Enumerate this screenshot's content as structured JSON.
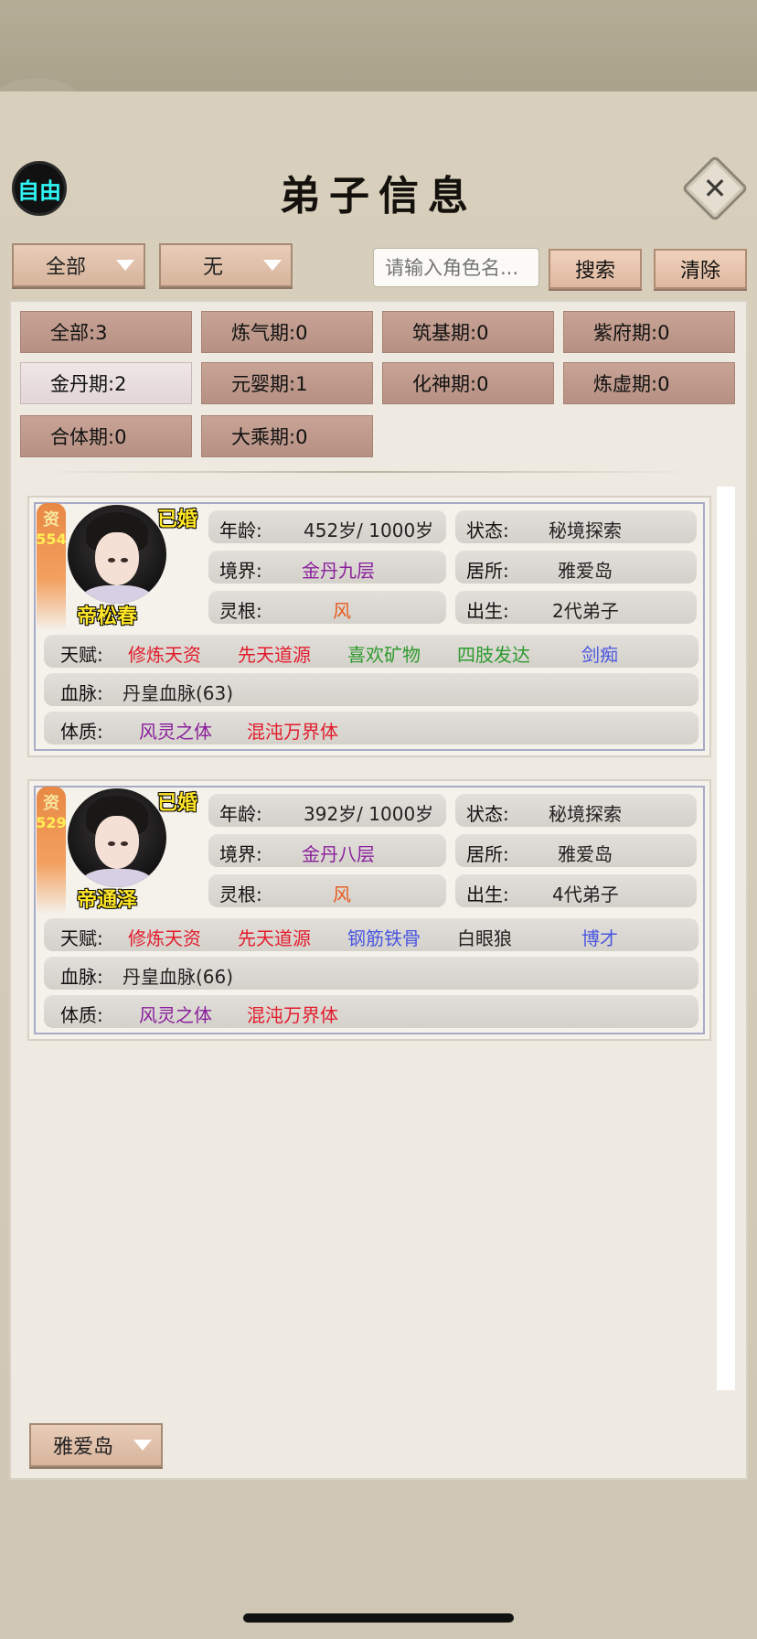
{
  "header": {
    "logo_label": "自由",
    "title": "弟子信息",
    "close_glyph": "✕"
  },
  "filters": {
    "category": "全部",
    "sub_filter": "无",
    "search_placeholder": "请输入角色名...",
    "search_label": "搜索",
    "clear_label": "清除"
  },
  "stages": [
    {
      "label": "全部:3",
      "active": false
    },
    {
      "label": "炼气期:0",
      "active": false
    },
    {
      "label": "筑基期:0",
      "active": false
    },
    {
      "label": "紫府期:0",
      "active": false
    },
    {
      "label": "金丹期:2",
      "active": true
    },
    {
      "label": "元婴期:1",
      "active": false
    },
    {
      "label": "化神期:0",
      "active": false
    },
    {
      "label": "炼虚期:0",
      "active": false
    },
    {
      "label": "合体期:0",
      "active": false
    },
    {
      "label": "大乘期:0",
      "active": false
    }
  ],
  "disciples": [
    {
      "aptitude_label": "资",
      "aptitude": "554",
      "married": "已婚",
      "name": "帝松春",
      "age_label": "年龄:",
      "age": "452岁/ 1000岁",
      "status_label": "状态:",
      "status": "秘境探索",
      "realm_label": "境界:",
      "realm": "金丹九层",
      "residence_label": "居所:",
      "residence": "雅爱岛",
      "root_label": "灵根:",
      "root": "风",
      "birth_label": "出生:",
      "birth": "2代弟子",
      "talent_label": "天赋:",
      "talents": [
        {
          "text": "修炼天资",
          "color": "#e21c2c"
        },
        {
          "text": "先天道源",
          "color": "#e21c2c"
        },
        {
          "text": "喜欢矿物",
          "color": "#2f9a2f"
        },
        {
          "text": "四肢发达",
          "color": "#2f9a2f"
        },
        {
          "text": "剑痴",
          "color": "#4a56e0"
        }
      ],
      "bloodline_label": "血脉:",
      "bloodline": "丹皇血脉(63)",
      "physique_label": "体质:",
      "physiques": [
        {
          "text": "风灵之体",
          "color": "#8a1f9c"
        },
        {
          "text": "混沌万界体",
          "color": "#e21c2c"
        }
      ]
    },
    {
      "aptitude_label": "资",
      "aptitude": "529",
      "married": "已婚",
      "name": "帝通泽",
      "age_label": "年龄:",
      "age": "392岁/ 1000岁",
      "status_label": "状态:",
      "status": "秘境探索",
      "realm_label": "境界:",
      "realm": "金丹八层",
      "residence_label": "居所:",
      "residence": "雅爱岛",
      "root_label": "灵根:",
      "root": "风",
      "birth_label": "出生:",
      "birth": "4代弟子",
      "talent_label": "天赋:",
      "talents": [
        {
          "text": "修炼天资",
          "color": "#e21c2c"
        },
        {
          "text": "先天道源",
          "color": "#e21c2c"
        },
        {
          "text": "钢筋铁骨",
          "color": "#4a56e0"
        },
        {
          "text": "白眼狼",
          "color": "#222222"
        },
        {
          "text": "博才",
          "color": "#4a56e0"
        }
      ],
      "bloodline_label": "血脉:",
      "bloodline": "丹皇血脉(66)",
      "physique_label": "体质:",
      "physiques": [
        {
          "text": "风灵之体",
          "color": "#8a1f9c"
        },
        {
          "text": "混沌万界体",
          "color": "#e21c2c"
        }
      ]
    }
  ],
  "footer": {
    "location": "雅爱岛"
  },
  "colors": {
    "accent_yellow": "#ffe628",
    "logo_cyan": "#2ff5f5",
    "button_tan": "#dfb8a0"
  }
}
